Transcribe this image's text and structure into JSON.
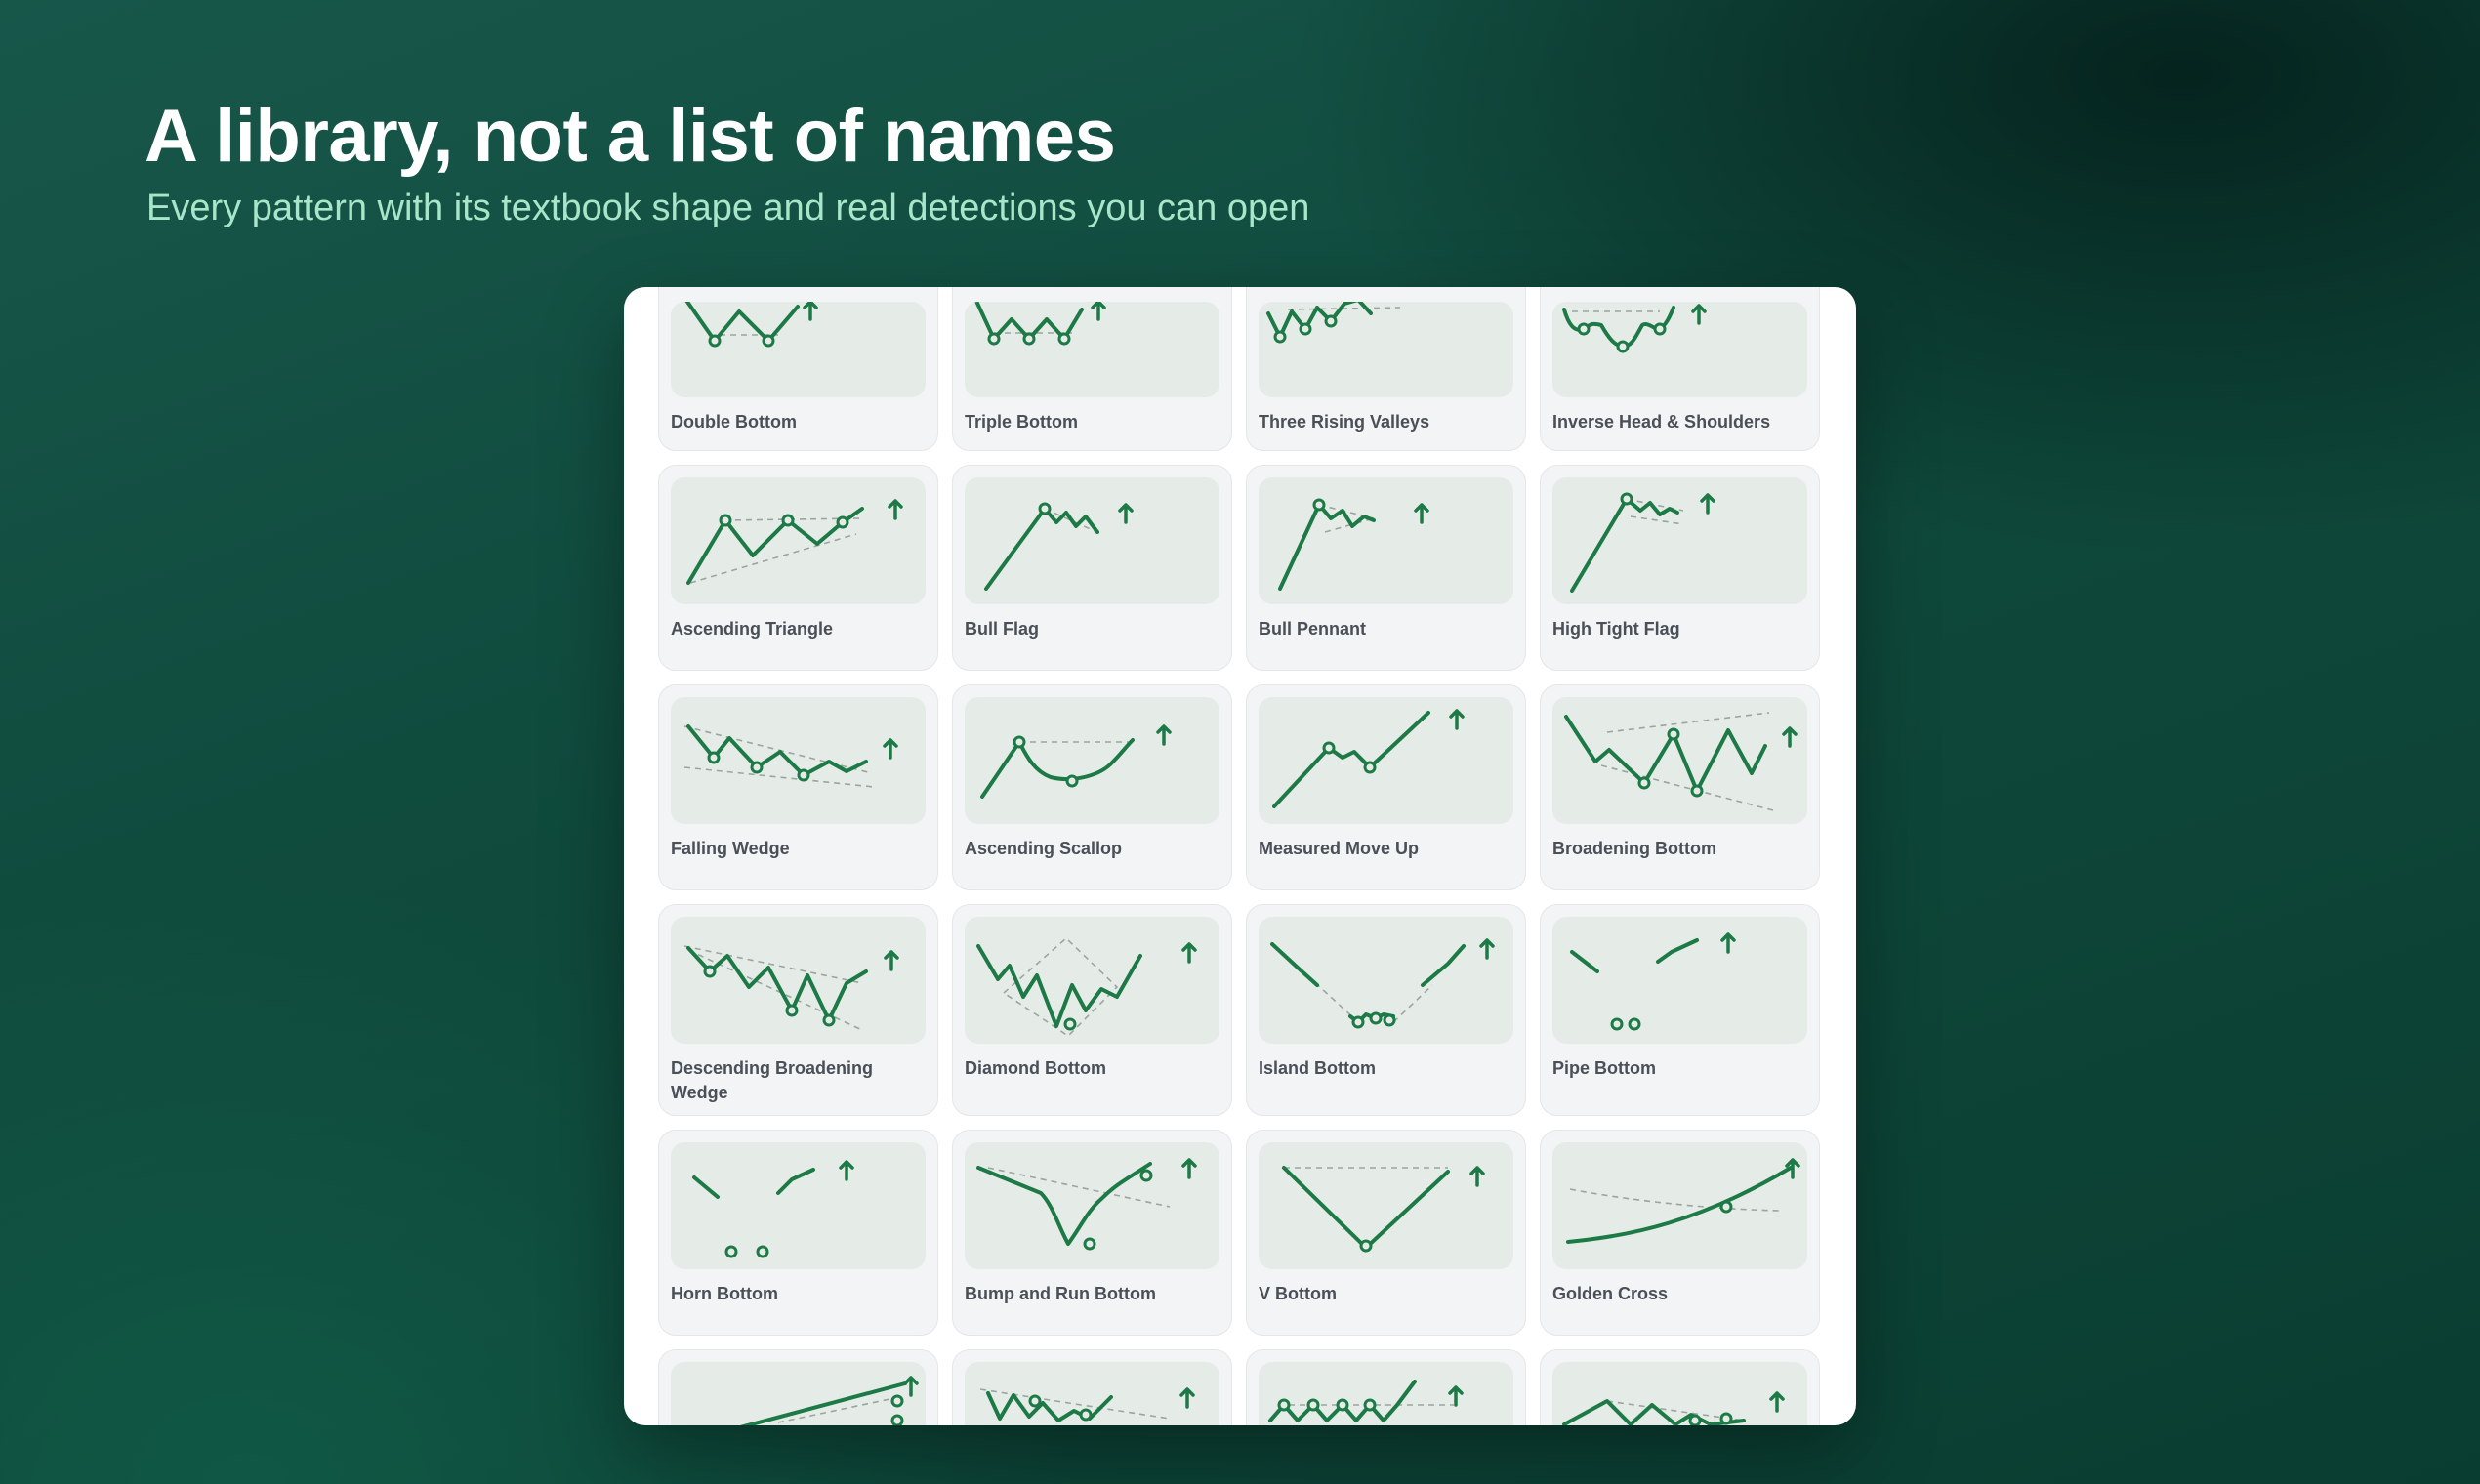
{
  "hero": {
    "title": "A library, not a list of names",
    "subtitle": "Every pattern with its textbook shape and real detections you can open"
  },
  "patterns": [
    {
      "label": "Double Bottom",
      "icon": "double-bottom-icon"
    },
    {
      "label": "Triple Bottom",
      "icon": "triple-bottom-icon"
    },
    {
      "label": "Three Rising Valleys",
      "icon": "three-rising-valleys-icon"
    },
    {
      "label": "Inverse Head & Shoulders",
      "icon": "inverse-head-and-shoulders-icon"
    },
    {
      "label": "Ascending Triangle",
      "icon": "ascending-triangle-icon"
    },
    {
      "label": "Bull Flag",
      "icon": "bull-flag-icon"
    },
    {
      "label": "Bull Pennant",
      "icon": "bull-pennant-icon"
    },
    {
      "label": "High Tight Flag",
      "icon": "high-tight-flag-icon"
    },
    {
      "label": "Falling Wedge",
      "icon": "falling-wedge-icon"
    },
    {
      "label": "Ascending Scallop",
      "icon": "ascending-scallop-icon"
    },
    {
      "label": "Measured Move Up",
      "icon": "measured-move-up-icon"
    },
    {
      "label": "Broadening Bottom",
      "icon": "broadening-bottom-icon"
    },
    {
      "label": "Descending Broadening Wedge",
      "icon": "descending-broadening-wedge-icon"
    },
    {
      "label": "Diamond Bottom",
      "icon": "diamond-bottom-icon"
    },
    {
      "label": "Island Bottom",
      "icon": "island-bottom-icon"
    },
    {
      "label": "Pipe Bottom",
      "icon": "pipe-bottom-icon"
    },
    {
      "label": "Horn Bottom",
      "icon": "horn-bottom-icon"
    },
    {
      "label": "Bump and Run Bottom",
      "icon": "bump-and-run-bottom-icon"
    },
    {
      "label": "V Bottom",
      "icon": "v-bottom-icon"
    },
    {
      "label": "Golden Cross",
      "icon": "golden-cross-icon"
    },
    {
      "label": "",
      "icon": "rising-channel-breakout-icon"
    },
    {
      "label": "",
      "icon": "descending-zigzag-icon"
    },
    {
      "label": "",
      "icon": "multiple-bottom-icon"
    },
    {
      "label": "",
      "icon": "descending-triangle-breakout-icon"
    }
  ],
  "colors": {
    "accent": "#1d7a46",
    "title": "#ffffff",
    "subtitle": "#a7e6c9",
    "card_bg": "#f3f4f6",
    "thumb_bg": "#e5ece8",
    "label": "#4a5058"
  }
}
